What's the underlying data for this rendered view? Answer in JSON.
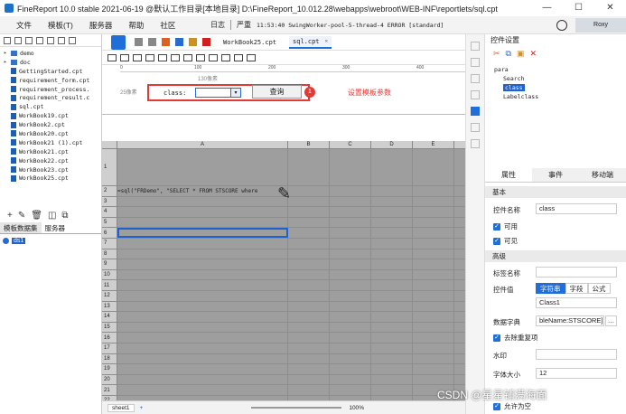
{
  "window": {
    "title": "FineReport 10.0 stable 2021-06-19 @默认工作目录[本地目录]   D:\\FineReport_10.012.28\\webapps\\webroot\\WEB-INF\\reportlets/sql.cpt",
    "min": "—",
    "max": "☐",
    "close": "✕"
  },
  "menu": {
    "items": [
      "文件",
      "模板(T)",
      "服务器",
      "帮助",
      "社区"
    ],
    "log_label": "日志",
    "severity": "严重",
    "log_text": "11:53:40 SwingWorker-pool-5-thread-4 ERROR [standard]",
    "user": "Roxy"
  },
  "filetree": {
    "items": [
      {
        "name": "demo",
        "type": "folder"
      },
      {
        "name": "doc",
        "type": "folder"
      },
      {
        "name": "GettingStarted.cpt",
        "type": "file"
      },
      {
        "name": "requirement_form.cpt",
        "type": "file"
      },
      {
        "name": "requirement_process.",
        "type": "file"
      },
      {
        "name": "requirement_result.c",
        "type": "file"
      },
      {
        "name": "sql.cpt",
        "type": "file"
      },
      {
        "name": "WorkBook19.cpt",
        "type": "file"
      },
      {
        "name": "WorkBook2.cpt",
        "type": "file"
      },
      {
        "name": "WorkBook20.cpt",
        "type": "file"
      },
      {
        "name": "WorkBook21 (1).cpt",
        "type": "file"
      },
      {
        "name": "WorkBook21.cpt",
        "type": "file"
      },
      {
        "name": "WorkBook22.cpt",
        "type": "file"
      },
      {
        "name": "WorkBook23.cpt",
        "type": "file"
      },
      {
        "name": "WorkBook25.cpt",
        "type": "file"
      }
    ]
  },
  "datasource": {
    "tab_template": "模板数据集",
    "tab_server": "服务器",
    "item": "ds1"
  },
  "tabs": [
    {
      "label": "WorkBook25.cpt",
      "active": false
    },
    {
      "label": "sql.cpt",
      "active": true
    }
  ],
  "ruler": {
    "ticks": [
      "0",
      "100",
      "200",
      "300",
      "400"
    ]
  },
  "params": {
    "pixel_hint_top": "130像素",
    "pixel_hint_left": "25像素",
    "label": "class:",
    "query_button": "查询",
    "annotation_num": "1",
    "annotation_text": "设置模板参数"
  },
  "sheet": {
    "columns": [
      "A",
      "B",
      "C",
      "D",
      "E"
    ],
    "rows": [
      "1",
      "2",
      "3",
      "4",
      "5",
      "6",
      "7",
      "8",
      "9",
      "10",
      "11",
      "12",
      "13",
      "14",
      "15",
      "16",
      "17",
      "18",
      "19",
      "20",
      "21",
      "22"
    ],
    "formula": "=sql(\"FRDemo\", \"SELECT * FROM STSCORE where",
    "tab": "sheet1",
    "zoom": "100",
    "zoom_unit": "%"
  },
  "widget_panel": {
    "title": "控件设置",
    "tree": [
      "para",
      "Search",
      "class",
      "Labelclass"
    ]
  },
  "props": {
    "tabs": [
      "属性",
      "事件",
      "移动端"
    ],
    "section_basic": "基本",
    "name_label": "控件名称",
    "name_value": "class",
    "enabled_label": "可用",
    "visible_label": "可见",
    "section_adv": "高级",
    "tag_label": "标签名称",
    "value_label": "控件值",
    "value_tabs": [
      "字符串",
      "字段",
      "公式"
    ],
    "value_value": "Class1",
    "dict_label": "数据字典",
    "dict_value": "bleName:STSCORE]",
    "dedupe_label": "去除重复项",
    "watermark_label": "水印",
    "fontsize_label": "字体大小",
    "fontsize_value": "12",
    "allow_empty_label": "允许为空"
  },
  "watermark_csdn": "CSDN @星星铺满海面"
}
